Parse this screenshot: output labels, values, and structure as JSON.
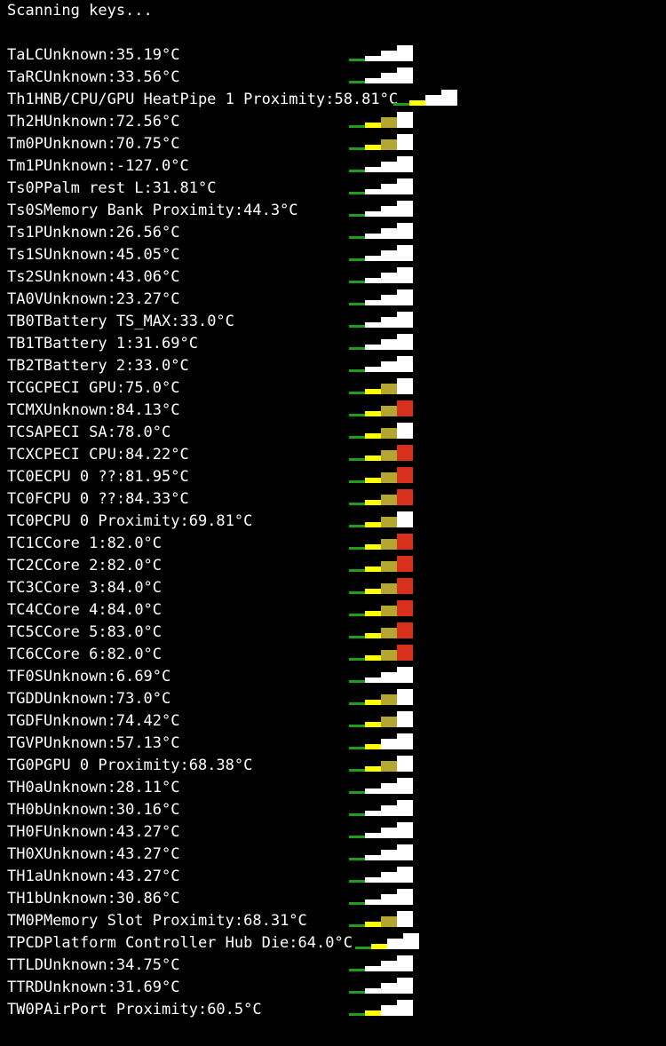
{
  "status_text": "Scanning keys...",
  "level_colors": {
    "0": [
      "#1f9d1f",
      "#ffffff",
      "#ffffff",
      "#ffffff"
    ],
    "1": [
      "#1f9d1f",
      "#ffff00",
      "#ffffff",
      "#ffffff"
    ],
    "2": [
      "#1f9d1f",
      "#ffff00",
      "#b5a632",
      "#ffffff"
    ],
    "3": [
      "#1f9d1f",
      "#ffff00",
      "#b5a632",
      "#d9301e"
    ]
  },
  "sensors": [
    {
      "key": "TaLC",
      "name": "Unknown:",
      "temp": "35.19°C",
      "level": 0
    },
    {
      "key": "TaRC",
      "name": "Unknown:",
      "temp": "33.56°C",
      "level": 0
    },
    {
      "key": "Th1H",
      "name": "NB/CPU/GPU HeatPipe 1 Proximity:",
      "temp": "58.81°C",
      "level": 1
    },
    {
      "key": "Th2H",
      "name": "Unknown:",
      "temp": "72.56°C",
      "level": 2
    },
    {
      "key": "Tm0P",
      "name": "Unknown:",
      "temp": "70.75°C",
      "level": 2
    },
    {
      "key": "Tm1P",
      "name": "Unknown:",
      "temp": "-127.0°C",
      "level": 0
    },
    {
      "key": "Ts0P",
      "name": "Palm rest L:",
      "temp": "31.81°C",
      "level": 0
    },
    {
      "key": "Ts0S",
      "name": "Memory Bank Proximity:",
      "temp": "44.3°C",
      "level": 0
    },
    {
      "key": "Ts1P",
      "name": "Unknown:",
      "temp": "26.56°C",
      "level": 0
    },
    {
      "key": "Ts1S",
      "name": "Unknown:",
      "temp": "45.05°C",
      "level": 0
    },
    {
      "key": "Ts2S",
      "name": "Unknown:",
      "temp": "43.06°C",
      "level": 0
    },
    {
      "key": "TA0V",
      "name": "Unknown:",
      "temp": "23.27°C",
      "level": 0
    },
    {
      "key": "TB0T",
      "name": "Battery TS_MAX:",
      "temp": "33.0°C",
      "level": 0
    },
    {
      "key": "TB1T",
      "name": "Battery 1:",
      "temp": "31.69°C",
      "level": 0
    },
    {
      "key": "TB2T",
      "name": "Battery 2:",
      "temp": "33.0°C",
      "level": 0
    },
    {
      "key": "TCGC",
      "name": "PECI GPU:",
      "temp": "75.0°C",
      "level": 2
    },
    {
      "key": "TCMX",
      "name": "Unknown:",
      "temp": "84.13°C",
      "level": 3
    },
    {
      "key": "TCSA",
      "name": "PECI SA:",
      "temp": "78.0°C",
      "level": 2
    },
    {
      "key": "TCXC",
      "name": "PECI CPU:",
      "temp": "84.22°C",
      "level": 3
    },
    {
      "key": "TC0E",
      "name": "CPU 0 ??:",
      "temp": "81.95°C",
      "level": 3
    },
    {
      "key": "TC0F",
      "name": "CPU 0 ??:",
      "temp": "84.33°C",
      "level": 3
    },
    {
      "key": "TC0P",
      "name": "CPU 0 Proximity:",
      "temp": "69.81°C",
      "level": 2
    },
    {
      "key": "TC1C",
      "name": "Core 1:",
      "temp": "82.0°C",
      "level": 3
    },
    {
      "key": "TC2C",
      "name": "Core 2:",
      "temp": "82.0°C",
      "level": 3
    },
    {
      "key": "TC3C",
      "name": "Core 3:",
      "temp": "84.0°C",
      "level": 3
    },
    {
      "key": "TC4C",
      "name": "Core 4:",
      "temp": "84.0°C",
      "level": 3
    },
    {
      "key": "TC5C",
      "name": "Core 5:",
      "temp": "83.0°C",
      "level": 3
    },
    {
      "key": "TC6C",
      "name": "Core 6:",
      "temp": "82.0°C",
      "level": 3
    },
    {
      "key": "TF0S",
      "name": "Unknown:",
      "temp": "6.69°C",
      "level": 0
    },
    {
      "key": "TGDD",
      "name": "Unknown:",
      "temp": "73.0°C",
      "level": 2
    },
    {
      "key": "TGDF",
      "name": "Unknown:",
      "temp": "74.42°C",
      "level": 2
    },
    {
      "key": "TGVP",
      "name": "Unknown:",
      "temp": "57.13°C",
      "level": 1
    },
    {
      "key": "TG0P",
      "name": "GPU 0 Proximity:",
      "temp": "68.38°C",
      "level": 2
    },
    {
      "key": "TH0a",
      "name": "Unknown:",
      "temp": "28.11°C",
      "level": 0
    },
    {
      "key": "TH0b",
      "name": "Unknown:",
      "temp": "30.16°C",
      "level": 0
    },
    {
      "key": "TH0F",
      "name": "Unknown:",
      "temp": "43.27°C",
      "level": 0
    },
    {
      "key": "TH0X",
      "name": "Unknown:",
      "temp": "43.27°C",
      "level": 0
    },
    {
      "key": "TH1a",
      "name": "Unknown:",
      "temp": "43.27°C",
      "level": 0
    },
    {
      "key": "TH1b",
      "name": "Unknown:",
      "temp": "30.86°C",
      "level": 0
    },
    {
      "key": "TM0P",
      "name": "Memory Slot Proximity:",
      "temp": "68.31°C",
      "level": 2
    },
    {
      "key": "TPCD",
      "name": "Platform Controller Hub Die:",
      "temp": "64.0°C",
      "level": 1
    },
    {
      "key": "TTLD",
      "name": "Unknown:",
      "temp": "34.75°C",
      "level": 0
    },
    {
      "key": "TTRD",
      "name": "Unknown:",
      "temp": "31.69°C",
      "level": 0
    },
    {
      "key": "TW0P",
      "name": "AirPort Proximity:",
      "temp": "60.5°C",
      "level": 1
    }
  ]
}
